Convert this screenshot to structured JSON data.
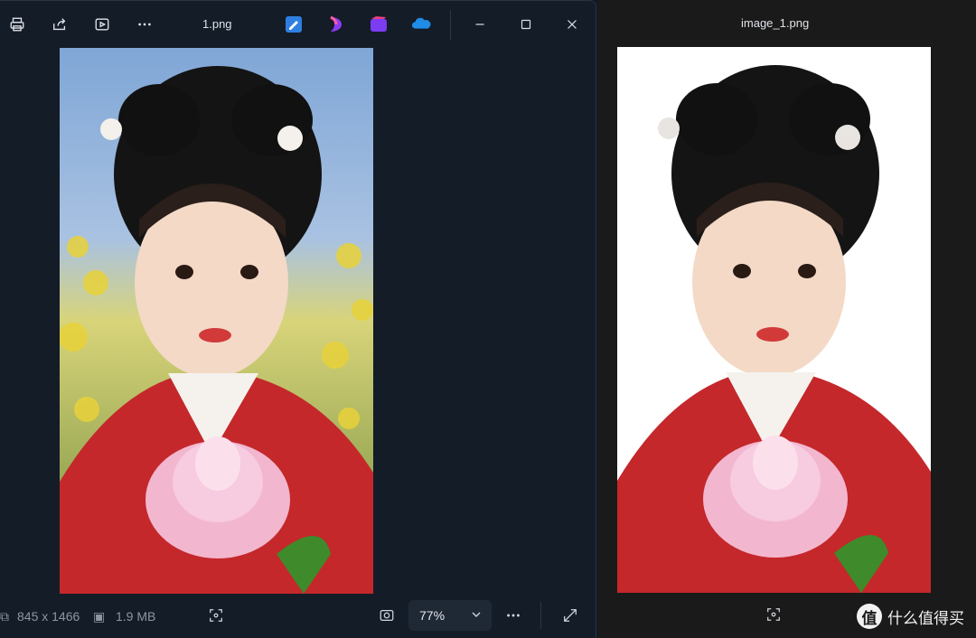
{
  "left_window": {
    "title": "1.png",
    "toolbar_icons": [
      "print-icon",
      "share-icon",
      "slideshow-icon",
      "more-icon"
    ],
    "app_icons": [
      "editor-app-icon",
      "designer-app-icon",
      "clipchamp-app-icon",
      "onedrive-icon"
    ],
    "status": {
      "dimensions": "845 x 1466",
      "file_size": "1.9 MB",
      "zoom": "77%"
    }
  },
  "right_window": {
    "title": "image_1.png"
  },
  "watermark": {
    "logo": "值",
    "text": "什么值得买"
  },
  "colors": {
    "left_bg": "#141c28",
    "right_bg": "#1a1a1a",
    "text_muted": "#8d96a3"
  }
}
